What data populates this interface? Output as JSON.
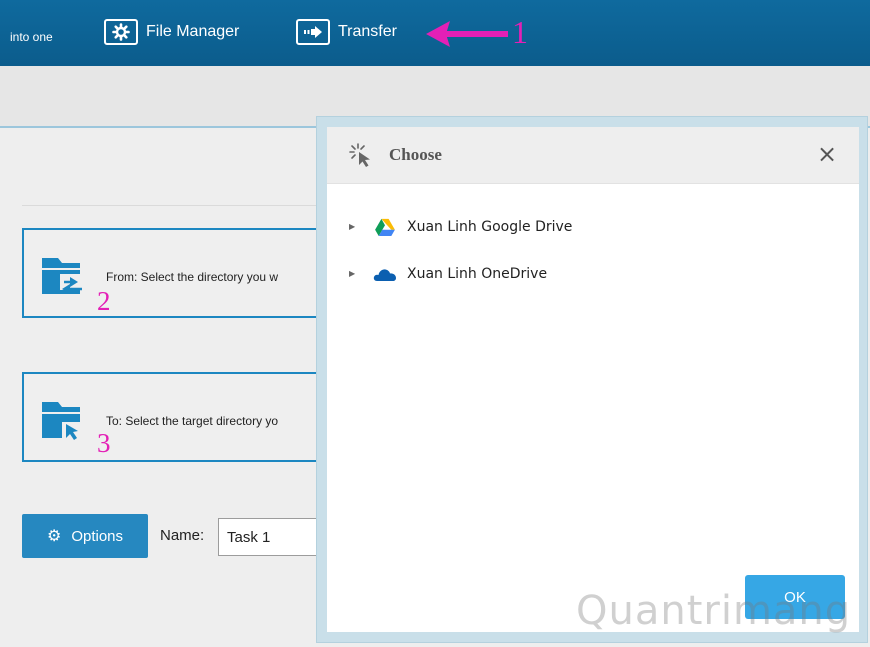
{
  "topbar": {
    "brand_tail": "into one",
    "file_manager_label": "File Manager",
    "transfer_label": "Transfer"
  },
  "transfer": {
    "from_text": "From: Select the directory you w",
    "to_text": "To: Select the target directory yo",
    "options_label": "Options",
    "name_label": "Name:",
    "name_value": "Task 1"
  },
  "annotations": {
    "one": "1",
    "two": "2",
    "three": "3"
  },
  "dialog": {
    "title": "Choose",
    "close_glyph": "×",
    "items": [
      {
        "label": "Xuan Linh Google Drive",
        "icon": "google-drive-icon"
      },
      {
        "label": "Xuan Linh OneDrive",
        "icon": "onedrive-icon"
      }
    ],
    "ok_label": "OK"
  },
  "watermark": "Quantrimang",
  "colors": {
    "topbar": "#0f6a9e",
    "accent": "#2688c0",
    "ok_button": "#36a7e5",
    "annotation": "#e320b6"
  }
}
